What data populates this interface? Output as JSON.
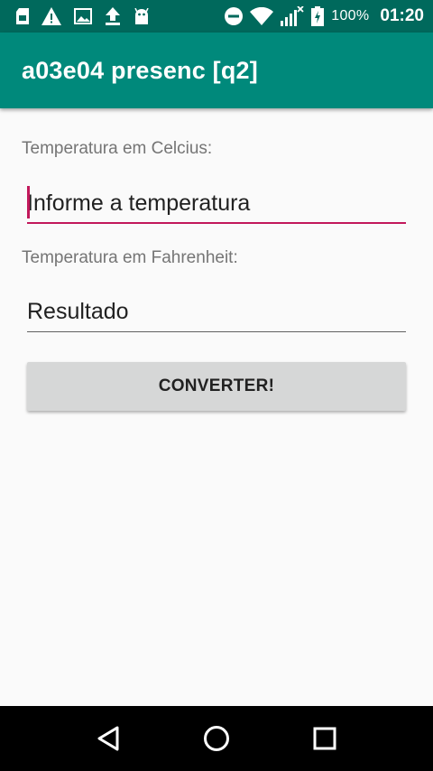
{
  "status_bar": {
    "icons_left": [
      "sd-card-icon",
      "warning-icon",
      "image-icon",
      "upload-icon",
      "android-icon"
    ],
    "icons_right": [
      "do-not-disturb-icon",
      "wifi-icon",
      "signal-icon",
      "battery-icon"
    ],
    "battery_pct": "100%",
    "time": "01:20"
  },
  "app_bar": {
    "title": "a03e04 presenc [q2]",
    "background": "#00897b",
    "status_background": "#00695c"
  },
  "form": {
    "celsius_label": "Temperatura em Celcius:",
    "celsius_placeholder": "Informe a temperatura",
    "celsius_value": "",
    "fahrenheit_label": "Temperatura em Fahrenheit:",
    "fahrenheit_placeholder": "Resultado",
    "fahrenheit_value": "",
    "accent_color": "#c2185b"
  },
  "button": {
    "convert_label": "CONVERTER!"
  },
  "nav_bar": {
    "buttons": [
      "back-icon",
      "home-icon",
      "recents-icon"
    ]
  }
}
